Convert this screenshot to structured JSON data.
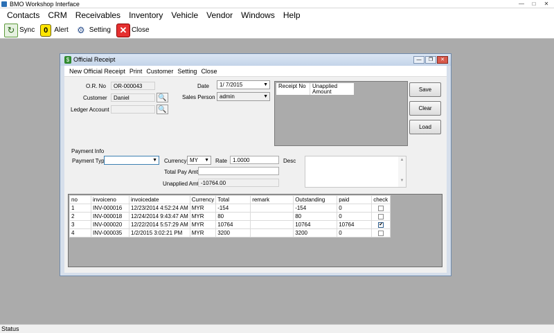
{
  "app": {
    "title": "BMO Workshop Interface",
    "status": "Status"
  },
  "menu": [
    "Contacts",
    "CRM",
    "Receivables",
    "Inventory",
    "Vehicle",
    "Vendor",
    "Windows",
    "Help"
  ],
  "toolbar": {
    "sync": "Sync",
    "alert": "Alert",
    "alert_glyph": "0",
    "setting": "Setting",
    "close": "Close"
  },
  "receipt_window": {
    "title": "Official Receipt",
    "menu": [
      "New Official Receipt",
      "Print",
      "Customer",
      "Setting",
      "Close"
    ],
    "labels": {
      "or_no": "O.R. No",
      "customer": "Customer",
      "ledger_account": "Ledger Account",
      "date": "Date",
      "sales_person": "Sales Person",
      "payment_info": "Payment Info",
      "payment_type": "Payment Type",
      "currency": "Currency",
      "rate": "Rate",
      "desc": "Desc",
      "total_pay_amt": "Total Pay Amt",
      "unapplied_amt": "Unapplied Amt"
    },
    "values": {
      "or_no": "OR-000043",
      "customer": "Daniel",
      "ledger_account": "",
      "date": "1/  7/2015",
      "sales_person": "admin",
      "payment_type": "",
      "currency": "MY",
      "rate": "1.0000",
      "total_pay_amt": "",
      "unapplied_amt": "-10764.00",
      "desc": ""
    },
    "receipt_columns": [
      "Receipt No",
      "Unapplied Amount"
    ],
    "buttons": {
      "save": "Save",
      "clear": "Clear",
      "load": "Load"
    },
    "grid": {
      "columns": [
        "no",
        "invoiceno",
        "invoicedate",
        "Currency",
        "Total",
        "remark",
        "Outstanding",
        "paid",
        "check"
      ],
      "rows": [
        {
          "no": "1",
          "invoiceno": "INV-000016",
          "invoicedate": "12/23/2014 4:52:24 AM",
          "currency": "MYR",
          "total": "-154",
          "remark": "",
          "outstanding": "-154",
          "paid": "0",
          "check": false
        },
        {
          "no": "2",
          "invoiceno": "INV-000018",
          "invoicedate": "12/24/2014 9:43:47 AM",
          "currency": "MYR",
          "total": "80",
          "remark": "",
          "outstanding": "80",
          "paid": "0",
          "check": false
        },
        {
          "no": "3",
          "invoiceno": "INV-000020",
          "invoicedate": "12/22/2014 5:57:29 AM",
          "currency": "MYR",
          "total": "10764",
          "remark": "",
          "outstanding": "10764",
          "paid": "10764",
          "check": true
        },
        {
          "no": "4",
          "invoiceno": "INV-000035",
          "invoicedate": "1/2/2015 3:02:21 PM",
          "currency": "MYR",
          "total": "3200",
          "remark": "",
          "outstanding": "3200",
          "paid": "0",
          "check": false
        }
      ]
    }
  }
}
